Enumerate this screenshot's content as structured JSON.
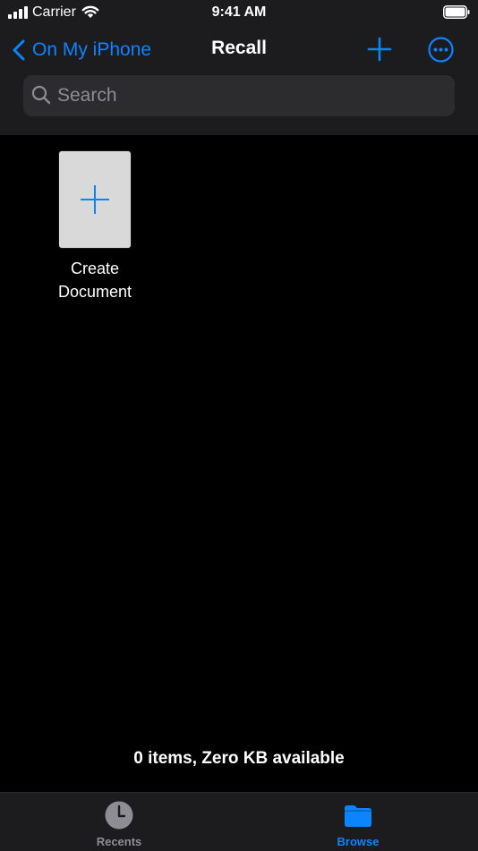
{
  "status_bar": {
    "carrier": "Carrier",
    "time": "9:41 AM"
  },
  "nav": {
    "back_label": "On My iPhone",
    "title": "Recall"
  },
  "search": {
    "placeholder": "Search"
  },
  "create_document": {
    "label_line1": "Create",
    "label_line2": "Document"
  },
  "footer": {
    "status_text": "0 items, Zero KB available"
  },
  "tab_bar": {
    "tabs": [
      {
        "label": "Recents",
        "icon": "clock-icon",
        "selected": false
      },
      {
        "label": "Browse",
        "icon": "folder-icon",
        "selected": true
      }
    ]
  },
  "colors": {
    "accent": "#0a84ff",
    "bar_background": "#1c1c1e",
    "search_field": "#2c2c2e",
    "inactive": "#8d8d93"
  }
}
